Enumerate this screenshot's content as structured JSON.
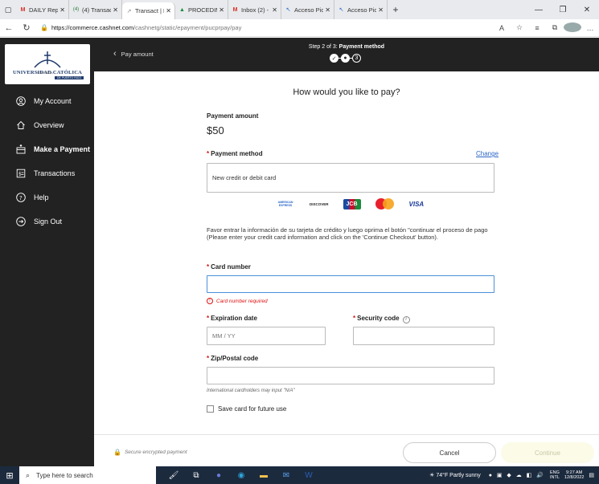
{
  "browser": {
    "tabs": [
      {
        "label": "DAILY Report",
        "icon": "M"
      },
      {
        "label": "(4) Transact Payme",
        "icon": "(4)"
      },
      {
        "label": "Transact | Make",
        "icon": "↗",
        "active": true
      },
      {
        "label": "PROCEDIMIEN",
        "icon": "▲"
      },
      {
        "label": "Inbox (2) - teso",
        "icon": "M"
      },
      {
        "label": "Acceso Pioner",
        "icon": "↖"
      },
      {
        "label": "Acceso Pioner",
        "icon": "↖"
      }
    ],
    "url_domain": "https://commerce.cashnet.com",
    "url_path": "/cashnetg/static/epayment/pucprpay/pay"
  },
  "sidebar": {
    "logo_text": "UNIVERSIDAD CATÓLICA",
    "logo_small": "PONTIFICIA",
    "logo_sub": "DE PUERTO RICO",
    "items": [
      {
        "label": "My Account",
        "icon": "user-circle-icon"
      },
      {
        "label": "Overview",
        "icon": "home-icon"
      },
      {
        "label": "Make a Payment",
        "icon": "payment-icon",
        "active": true
      },
      {
        "label": "Transactions",
        "icon": "receipt-icon"
      },
      {
        "label": "Help",
        "icon": "question-circle-icon"
      },
      {
        "label": "Sign Out",
        "icon": "sign-out-icon"
      }
    ]
  },
  "header": {
    "back_label": "Pay amount",
    "step_prefix": "Step 2 of 3:",
    "step_name": "Payment method",
    "step3": "3"
  },
  "main": {
    "heading": "How would you like to pay?",
    "payment_amount_label": "Payment amount",
    "amount": "$50",
    "payment_method_label": "Payment method",
    "change_label": "Change",
    "payment_method_value": "New credit or debit card",
    "card_brands": [
      "AMERICAN EXPRESS",
      "DISCOVER",
      "JCB",
      "MasterCard",
      "VISA"
    ],
    "info_text": "Favor entrar la información de su tarjeta de crédito y luego oprima el botón \"continuar el proceso de pago (Please enter your credit card information and click on the 'Continue Checkout' button).",
    "card_number_label": "Card number",
    "card_number_value": "",
    "card_number_error": "Card number required",
    "expiration_label": "Expiration date",
    "expiration_placeholder": "MM / YY",
    "security_label": "Security code",
    "zip_label": "Zip/Postal code",
    "zip_value": "",
    "intl_hint": "International cardholders may input \"N/A\"",
    "save_card_label": "Save card for future use",
    "secure_label": "Secure encrypted payment",
    "cancel_label": "Cancel",
    "continue_label": "Continue"
  },
  "taskbar": {
    "search_placeholder": "Type here to search",
    "weather": "74°F  Partly sunny",
    "lang": "ENG",
    "lang_sub": "INTL",
    "time": "9:27 AM",
    "date": "12/8/2022"
  }
}
